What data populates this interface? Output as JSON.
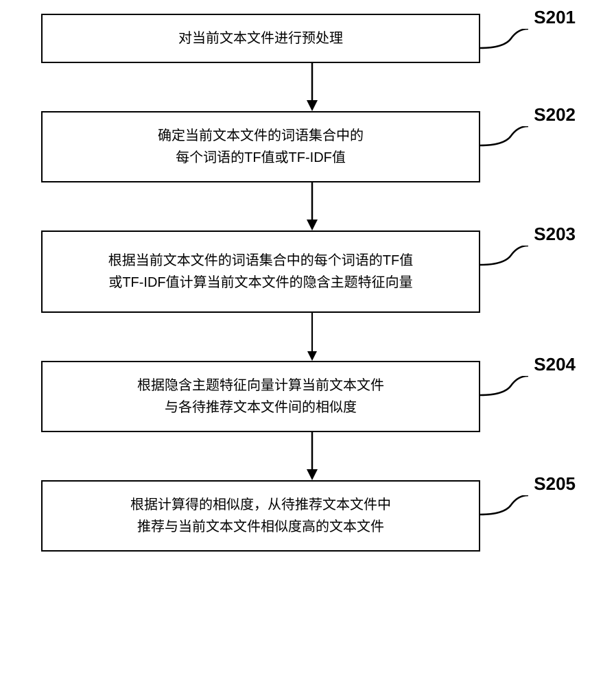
{
  "chart_data": {
    "type": "flowchart",
    "direction": "top-down",
    "title": "",
    "nodes": [
      {
        "id": "S201",
        "label": "S201",
        "text": "对当前文本文件进行预处理"
      },
      {
        "id": "S202",
        "label": "S202",
        "text": "确定当前文本文件的词语集合中的\n每个词语的TF值或TF-IDF值"
      },
      {
        "id": "S203",
        "label": "S203",
        "text": "根据当前文本文件的词语集合中的每个词语的TF值\n或TF-IDF值计算当前文本文件的隐含主题特征向量"
      },
      {
        "id": "S204",
        "label": "S204",
        "text": "根据隐含主题特征向量计算当前文本文件\n与各待推荐文本文件间的相似度"
      },
      {
        "id": "S205",
        "label": "S205",
        "text": "根据计算得的相似度，从待推荐文本文件中\n推荐与当前文本文件相似度高的文本文件"
      }
    ],
    "edges": [
      {
        "from": "S201",
        "to": "S202"
      },
      {
        "from": "S202",
        "to": "S203"
      },
      {
        "from": "S203",
        "to": "S204"
      },
      {
        "from": "S204",
        "to": "S205"
      }
    ]
  }
}
